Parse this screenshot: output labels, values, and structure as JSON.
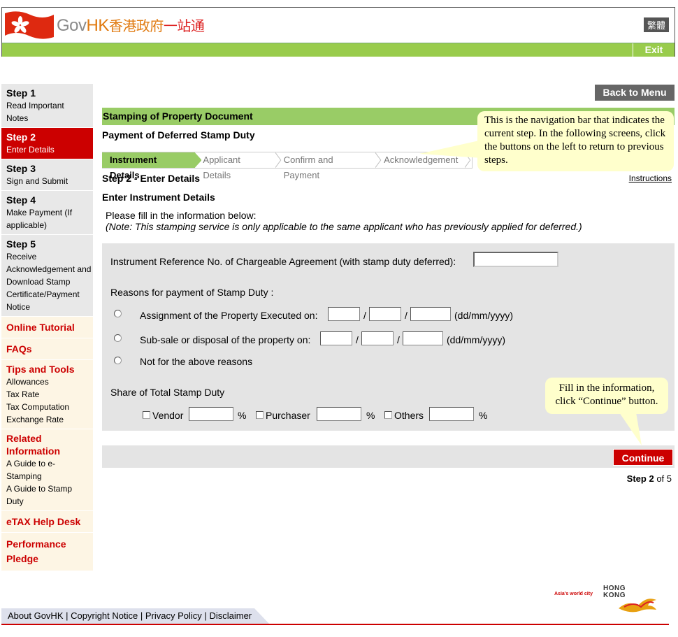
{
  "header": {
    "brand_gov": "Gov",
    "brand_hk": "HK",
    "brand_cn_1": "香港政府",
    "brand_cn_2": "一站通",
    "lang_label": "繁體",
    "exit_label": "Exit",
    "colors": {
      "green_bar": "#99cc4c",
      "accent_red": "#cc0000"
    }
  },
  "sidebar": {
    "step1": {
      "title": "Step 1",
      "text": "Read Important Notes"
    },
    "step2": {
      "title": "Step 2",
      "text": "Enter Details"
    },
    "step3": {
      "title": "Step 3",
      "text": "Sign and Submit"
    },
    "step4": {
      "title": "Step 4",
      "text": "Make Payment (If applicable)"
    },
    "step5": {
      "title": "Step 5",
      "text": "Receive Acknowledgement and Download Stamp Certificate/Payment Notice"
    },
    "online_tutorial": "Online Tutorial",
    "faqs": "FAQs",
    "tips": {
      "title": "Tips and Tools",
      "items": [
        "Allowances",
        "Tax Rate",
        "Tax Computation",
        "Exchange Rate"
      ]
    },
    "related": {
      "title": "Related Information",
      "items": [
        "A Guide to e-Stamping",
        "A Guide to Stamp Duty"
      ]
    },
    "etax": "eTAX Help Desk",
    "pledge": "Performance Pledge"
  },
  "main": {
    "back_to_menu": "Back to Menu",
    "service_title": "Stamping of Property Document",
    "page_subtitle": "Payment of Deferred Stamp Duty",
    "step_nav": [
      "Instrument Details",
      "Applicant Details",
      "Confirm and Payment",
      "Acknowledgement"
    ],
    "step_heading": "Step 2 - Enter Details",
    "instructions_link": "Instructions",
    "section_heading": "Enter Instrument Details",
    "fill_info": "Please fill in the information below:",
    "fill_note": "(Note: This stamping service is only applicable to the same applicant who has previously applied for deferred.)",
    "form": {
      "ref_label": "Instrument Reference No. of Chargeable Agreement (with stamp duty deferred):",
      "ref_value": "",
      "reasons_label": "Reasons for payment of Stamp Duty :",
      "reason_1": "Assignment of the Property Executed on:",
      "reason_2": "Sub-sale or disposal of the property on:",
      "reason_3": "Not for the above reasons",
      "date_sep": "/",
      "date_format": "(dd/mm/yyyy)",
      "share_label": "Share of Total Stamp Duty",
      "vendor": "Vendor",
      "purchaser": "Purchaser",
      "others": "Others",
      "percent": "%"
    },
    "continue_label": "Continue",
    "step_count_prefix": "Step",
    "step_count_current": "2",
    "step_count_suffix": "of 5"
  },
  "tooltips": {
    "nav_tip": "This is the navigation bar that indicates the current step. In the following screens, click the buttons on the left to return to previous steps.",
    "fill_tip": "Fill in the information, click “Continue” button."
  },
  "brand_logo": {
    "tagline": "Asia's world city",
    "word_1": "HONG",
    "word_2": "KONG"
  },
  "footer": {
    "about": "About GovHK",
    "copyright": "Copyright Notice",
    "privacy": "Privacy Policy",
    "disclaimer": "Disclaimer",
    "sep": "|"
  }
}
